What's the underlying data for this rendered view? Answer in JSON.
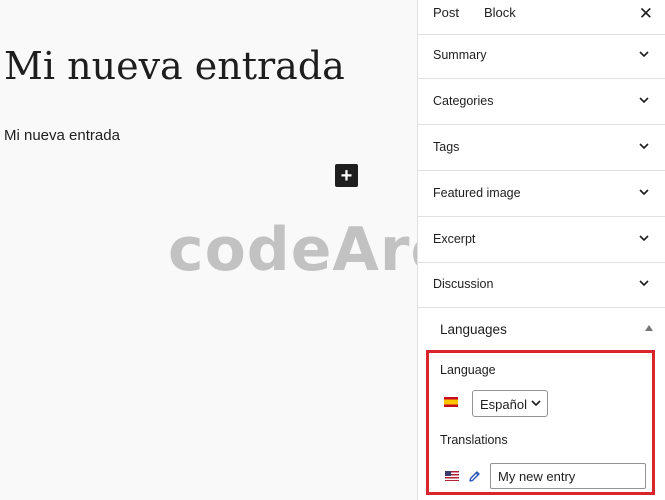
{
  "editor": {
    "title": "Mi nueva entrada",
    "paragraph": "Mi nueva entrada",
    "inserter_icon": "plus-icon"
  },
  "watermark": "codeArco",
  "sidebar": {
    "tabs": [
      {
        "label": "Post",
        "active": true
      },
      {
        "label": "Block",
        "active": false
      }
    ],
    "close_icon": "close-icon",
    "panels": [
      {
        "label": "Summary"
      },
      {
        "label": "Categories"
      },
      {
        "label": "Tags"
      },
      {
        "label": "Featured image"
      },
      {
        "label": "Excerpt"
      },
      {
        "label": "Discussion"
      }
    ],
    "languages": {
      "title": "Languages",
      "language_label": "Language",
      "language_flag": "spain-flag-icon",
      "language_value": "Español",
      "translations_label": "Translations",
      "translation_flag": "us-flag-icon",
      "translation_value": "My new entry"
    }
  },
  "colors": {
    "highlight": "#d9262d",
    "editor_bg": "#f9f9f9",
    "text": "#1e1e1e"
  }
}
